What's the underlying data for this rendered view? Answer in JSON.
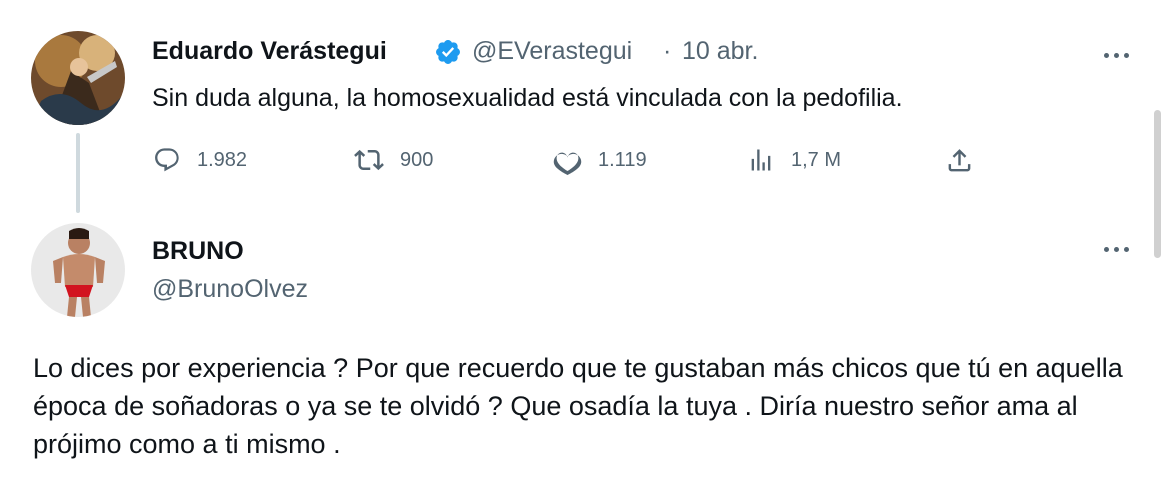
{
  "tweet": {
    "author_name": "Eduardo Verástegui",
    "handle": "@EVerastegui",
    "separator": "·",
    "date": "10 abr.",
    "text": "Sin duda alguna, la homosexualidad está vinculada con la pedofilia.",
    "stats": {
      "replies": "1.982",
      "retweets": "900",
      "likes": "1.119",
      "views": "1,7 M"
    },
    "icons": [
      "verified-badge-icon",
      "reply-icon",
      "retweet-icon",
      "like-icon",
      "views-icon",
      "share-icon",
      "more-options-icon"
    ],
    "colors": {
      "verified": "#1d9bf0",
      "muted": "#536471",
      "text": "#0f1419"
    }
  },
  "reply": {
    "author_name": "BRUNO",
    "handle": "@BrunoOlvez",
    "text": "Lo dices por experiencia ? Por que recuerdo que te gustaban más chicos que tú en aquella época de soñadoras o ya se te olvidó ? Que osadía la tuya . Diría nuestro señor ama al prójimo como a ti mismo ."
  }
}
